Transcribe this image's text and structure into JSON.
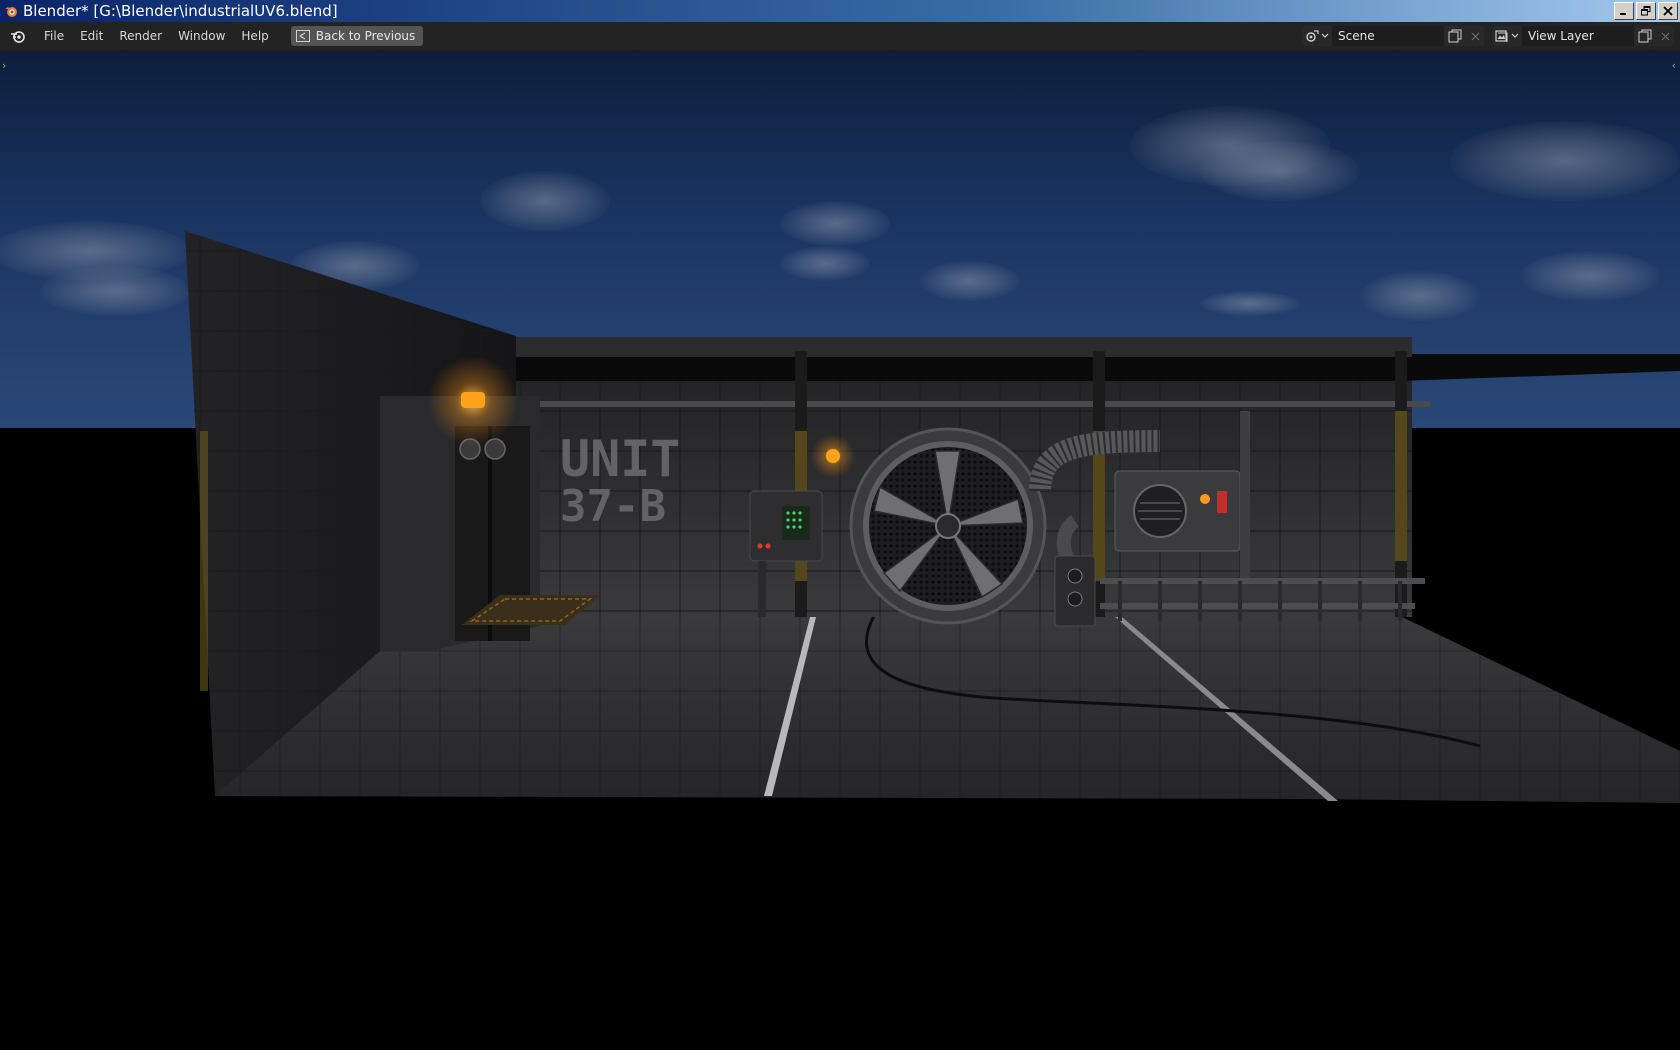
{
  "window": {
    "title": "Blender* [G:\\Blender\\industrialUV6.blend]"
  },
  "menu": {
    "items": [
      "File",
      "Edit",
      "Render",
      "Window",
      "Help"
    ]
  },
  "back_button": {
    "label": "Back to Previous"
  },
  "scene_selector": {
    "value": "Scene"
  },
  "view_layer_selector": {
    "value": "View Layer"
  },
  "render": {
    "sign_line1": "UNIT",
    "sign_line2": "37-B"
  },
  "colors": {
    "titlebar_start": "#0a246a",
    "titlebar_end": "#a6caf0",
    "topbar_bg": "#232323",
    "button_bg": "#545454",
    "lamp_orange": "#ffa31a"
  }
}
